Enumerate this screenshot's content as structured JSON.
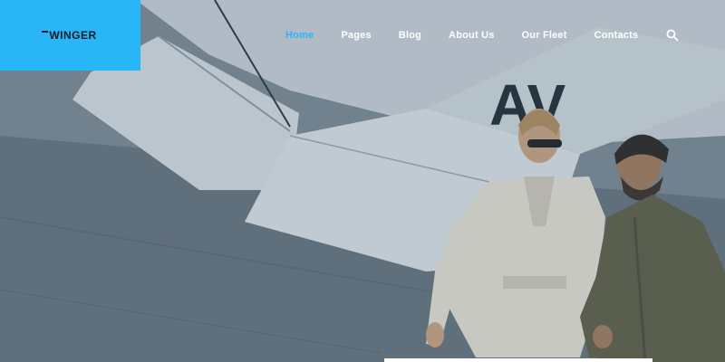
{
  "brand": {
    "logo_text": "WINGER"
  },
  "nav": {
    "items": [
      {
        "label": "Home",
        "active": true
      },
      {
        "label": "Pages",
        "active": false
      },
      {
        "label": "Blog",
        "active": false
      },
      {
        "label": "About Us",
        "active": false
      },
      {
        "label": "Our Fleet",
        "active": false
      },
      {
        "label": "Contacts",
        "active": false
      }
    ],
    "search_icon": "search-icon"
  },
  "hero": {
    "aircraft_marking": "AV"
  },
  "colors": {
    "accent": "#29b6f6",
    "nav_text": "#ffffff",
    "logo_text": "#0d1b26"
  }
}
